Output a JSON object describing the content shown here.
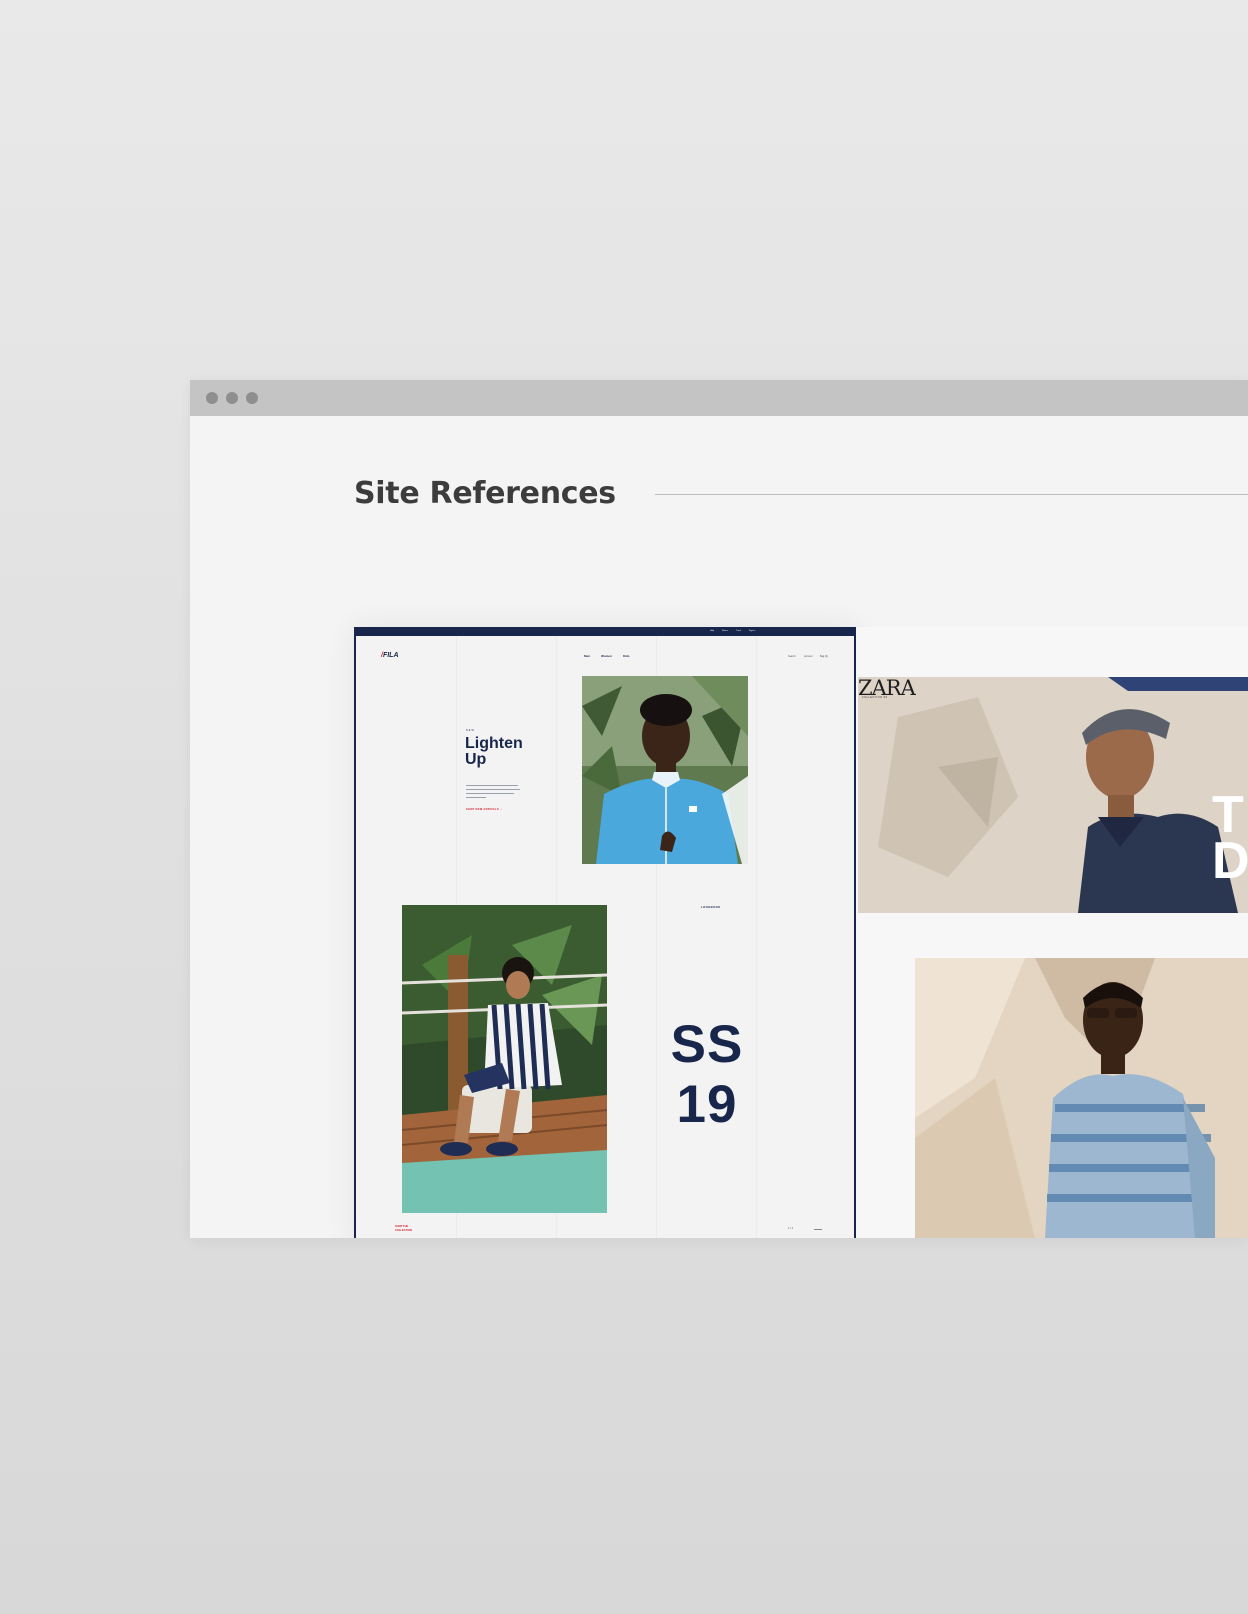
{
  "page": {
    "heading": "Site References"
  },
  "fila": {
    "logo": "FILA",
    "top_links": [
      "Help",
      "Stores",
      "Track",
      "Sign In"
    ],
    "nav": [
      "Men",
      "Women",
      "Kids"
    ],
    "utility": [
      "Search",
      "Account",
      "Bag (0)"
    ],
    "kicker": "NEW",
    "hero_title": "Lighten Up",
    "cta": "SHOP NEW ARRIVALS →",
    "lookbook": "LOOKBOOK",
    "season_line1": "SS",
    "season_line2": "19",
    "shop_collection_line1": "SHOP THE",
    "shop_collection_line2": "COLLECTION",
    "pager": "1 / 4"
  },
  "zara": {
    "logo": "ZARA",
    "sub": "COLLECTION SS",
    "big_line1": "T",
    "big_line2": "D"
  },
  "colors": {
    "fila_navy": "#17264a",
    "fila_red": "#d21a2b",
    "heading": "#3c3c3c"
  }
}
